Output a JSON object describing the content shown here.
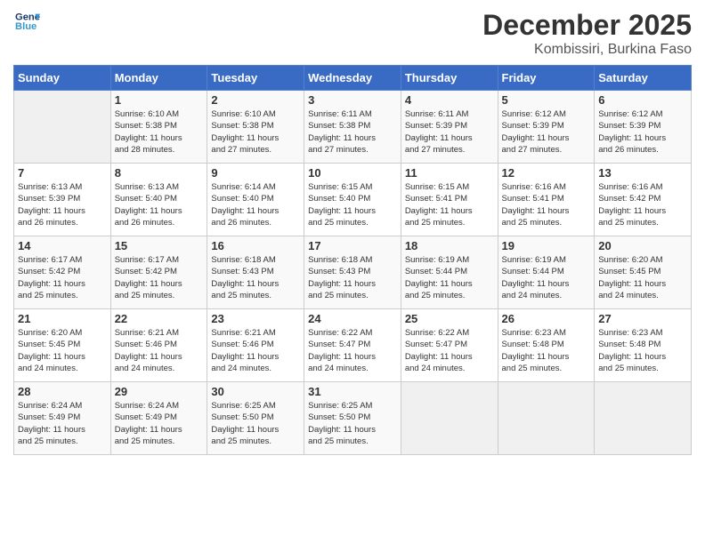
{
  "header": {
    "logo_line1": "General",
    "logo_line2": "Blue",
    "month": "December 2025",
    "location": "Kombissiri, Burkina Faso"
  },
  "weekdays": [
    "Sunday",
    "Monday",
    "Tuesday",
    "Wednesday",
    "Thursday",
    "Friday",
    "Saturday"
  ],
  "weeks": [
    [
      {
        "day": "",
        "info": ""
      },
      {
        "day": "1",
        "info": "Sunrise: 6:10 AM\nSunset: 5:38 PM\nDaylight: 11 hours\nand 28 minutes."
      },
      {
        "day": "2",
        "info": "Sunrise: 6:10 AM\nSunset: 5:38 PM\nDaylight: 11 hours\nand 27 minutes."
      },
      {
        "day": "3",
        "info": "Sunrise: 6:11 AM\nSunset: 5:38 PM\nDaylight: 11 hours\nand 27 minutes."
      },
      {
        "day": "4",
        "info": "Sunrise: 6:11 AM\nSunset: 5:39 PM\nDaylight: 11 hours\nand 27 minutes."
      },
      {
        "day": "5",
        "info": "Sunrise: 6:12 AM\nSunset: 5:39 PM\nDaylight: 11 hours\nand 27 minutes."
      },
      {
        "day": "6",
        "info": "Sunrise: 6:12 AM\nSunset: 5:39 PM\nDaylight: 11 hours\nand 26 minutes."
      }
    ],
    [
      {
        "day": "7",
        "info": "Sunrise: 6:13 AM\nSunset: 5:39 PM\nDaylight: 11 hours\nand 26 minutes."
      },
      {
        "day": "8",
        "info": "Sunrise: 6:13 AM\nSunset: 5:40 PM\nDaylight: 11 hours\nand 26 minutes."
      },
      {
        "day": "9",
        "info": "Sunrise: 6:14 AM\nSunset: 5:40 PM\nDaylight: 11 hours\nand 26 minutes."
      },
      {
        "day": "10",
        "info": "Sunrise: 6:15 AM\nSunset: 5:40 PM\nDaylight: 11 hours\nand 25 minutes."
      },
      {
        "day": "11",
        "info": "Sunrise: 6:15 AM\nSunset: 5:41 PM\nDaylight: 11 hours\nand 25 minutes."
      },
      {
        "day": "12",
        "info": "Sunrise: 6:16 AM\nSunset: 5:41 PM\nDaylight: 11 hours\nand 25 minutes."
      },
      {
        "day": "13",
        "info": "Sunrise: 6:16 AM\nSunset: 5:42 PM\nDaylight: 11 hours\nand 25 minutes."
      }
    ],
    [
      {
        "day": "14",
        "info": "Sunrise: 6:17 AM\nSunset: 5:42 PM\nDaylight: 11 hours\nand 25 minutes."
      },
      {
        "day": "15",
        "info": "Sunrise: 6:17 AM\nSunset: 5:42 PM\nDaylight: 11 hours\nand 25 minutes."
      },
      {
        "day": "16",
        "info": "Sunrise: 6:18 AM\nSunset: 5:43 PM\nDaylight: 11 hours\nand 25 minutes."
      },
      {
        "day": "17",
        "info": "Sunrise: 6:18 AM\nSunset: 5:43 PM\nDaylight: 11 hours\nand 25 minutes."
      },
      {
        "day": "18",
        "info": "Sunrise: 6:19 AM\nSunset: 5:44 PM\nDaylight: 11 hours\nand 25 minutes."
      },
      {
        "day": "19",
        "info": "Sunrise: 6:19 AM\nSunset: 5:44 PM\nDaylight: 11 hours\nand 24 minutes."
      },
      {
        "day": "20",
        "info": "Sunrise: 6:20 AM\nSunset: 5:45 PM\nDaylight: 11 hours\nand 24 minutes."
      }
    ],
    [
      {
        "day": "21",
        "info": "Sunrise: 6:20 AM\nSunset: 5:45 PM\nDaylight: 11 hours\nand 24 minutes."
      },
      {
        "day": "22",
        "info": "Sunrise: 6:21 AM\nSunset: 5:46 PM\nDaylight: 11 hours\nand 24 minutes."
      },
      {
        "day": "23",
        "info": "Sunrise: 6:21 AM\nSunset: 5:46 PM\nDaylight: 11 hours\nand 24 minutes."
      },
      {
        "day": "24",
        "info": "Sunrise: 6:22 AM\nSunset: 5:47 PM\nDaylight: 11 hours\nand 24 minutes."
      },
      {
        "day": "25",
        "info": "Sunrise: 6:22 AM\nSunset: 5:47 PM\nDaylight: 11 hours\nand 24 minutes."
      },
      {
        "day": "26",
        "info": "Sunrise: 6:23 AM\nSunset: 5:48 PM\nDaylight: 11 hours\nand 25 minutes."
      },
      {
        "day": "27",
        "info": "Sunrise: 6:23 AM\nSunset: 5:48 PM\nDaylight: 11 hours\nand 25 minutes."
      }
    ],
    [
      {
        "day": "28",
        "info": "Sunrise: 6:24 AM\nSunset: 5:49 PM\nDaylight: 11 hours\nand 25 minutes."
      },
      {
        "day": "29",
        "info": "Sunrise: 6:24 AM\nSunset: 5:49 PM\nDaylight: 11 hours\nand 25 minutes."
      },
      {
        "day": "30",
        "info": "Sunrise: 6:25 AM\nSunset: 5:50 PM\nDaylight: 11 hours\nand 25 minutes."
      },
      {
        "day": "31",
        "info": "Sunrise: 6:25 AM\nSunset: 5:50 PM\nDaylight: 11 hours\nand 25 minutes."
      },
      {
        "day": "",
        "info": ""
      },
      {
        "day": "",
        "info": ""
      },
      {
        "day": "",
        "info": ""
      }
    ]
  ]
}
